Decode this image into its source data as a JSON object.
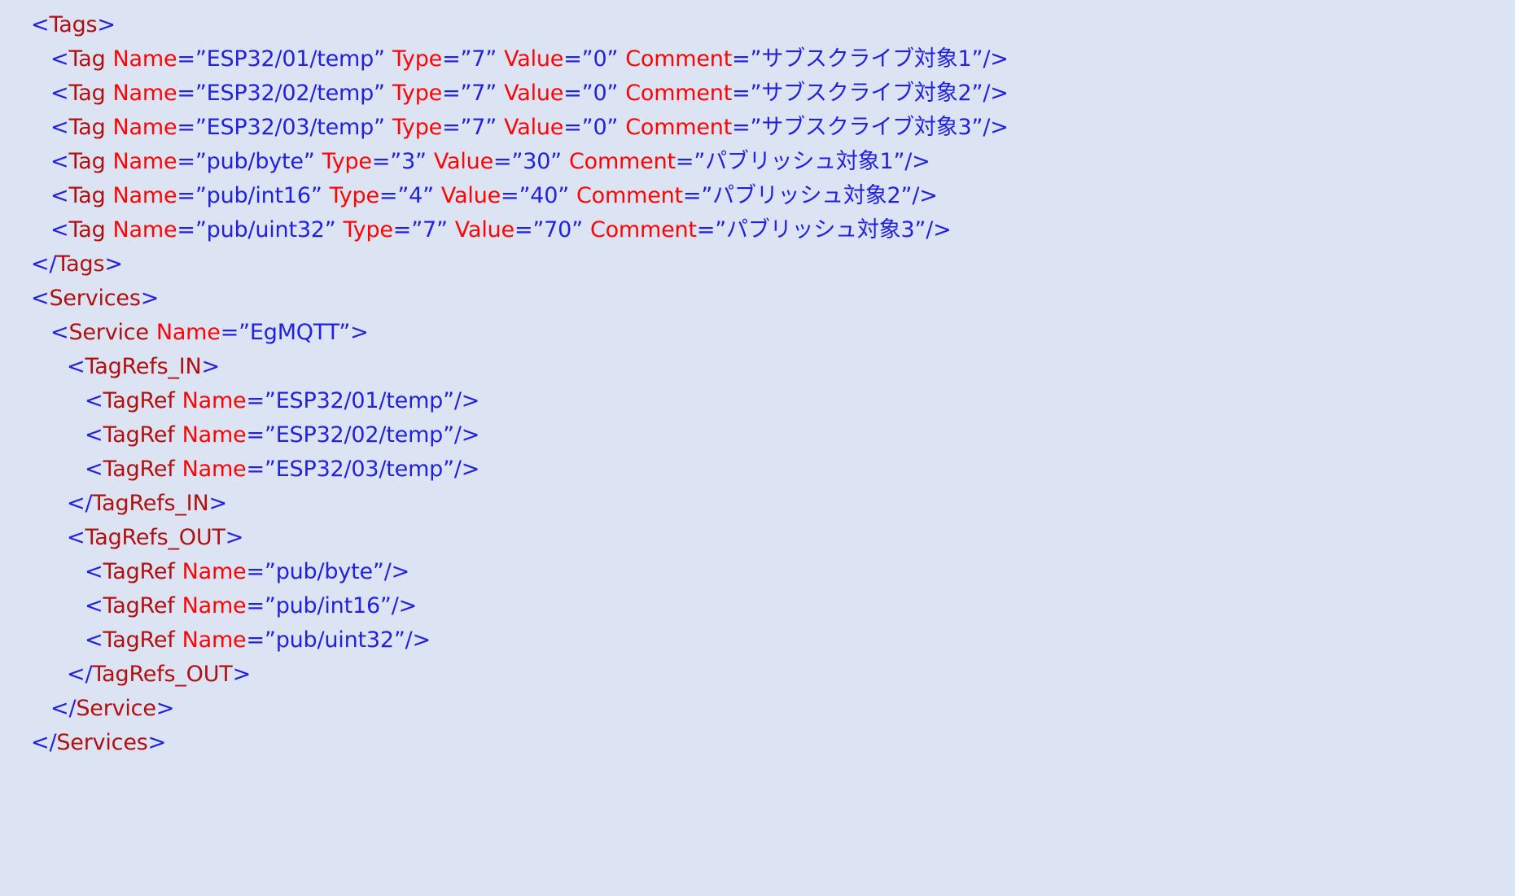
{
  "document": {
    "type": "xml-source-listing",
    "background_color": "#dce3f2",
    "colors": {
      "bracket": "#2222dd",
      "element_name": "#b01010",
      "attribute_name": "#fb0505",
      "attribute_value": "#2222dd"
    },
    "lines": [
      {
        "indent": 0,
        "text": "<Tags>"
      },
      {
        "indent": 1,
        "text": "<Tag Name=\"ESP32/01/temp\" Type=\"7\" Value=\"0\" Comment=\"サブスクライブ対象1\"/>"
      },
      {
        "indent": 1,
        "text": "<Tag Name=\"ESP32/02/temp\" Type=\"7\" Value=\"0\" Comment=\"サブスクライブ対象2\"/>"
      },
      {
        "indent": 1,
        "text": "<Tag Name=\"ESP32/03/temp\" Type=\"7\" Value=\"0\" Comment=\"サブスクライブ対象3\"/>"
      },
      {
        "indent": 1,
        "text": "<Tag Name=\"pub/byte\" Type=\"3\" Value=\"30\" Comment=\"パブリッシュ対象1\"/>"
      },
      {
        "indent": 1,
        "text": "<Tag Name=\"pub/int16\" Type=\"4\" Value=\"40\" Comment=\"パブリッシュ対象2\"/>"
      },
      {
        "indent": 1,
        "text": "<Tag Name=\"pub/uint32\" Type=\"7\" Value=\"70\" Comment=\"パブリッシュ対象3\"/>"
      },
      {
        "indent": 0,
        "text": "</Tags>"
      },
      {
        "indent": 0,
        "text": "<Services>"
      },
      {
        "indent": 1,
        "text": "<Service Name=\"EgMQTT\">"
      },
      {
        "indent": 2,
        "text": "<TagRefs_IN>"
      },
      {
        "indent": 3,
        "text": "<TagRef Name=\"ESP32/01/temp\"/>"
      },
      {
        "indent": 3,
        "text": "<TagRef Name=\"ESP32/02/temp\"/>"
      },
      {
        "indent": 3,
        "text": "<TagRef Name=\"ESP32/03/temp\"/>"
      },
      {
        "indent": 2,
        "text": "</TagRefs_IN>"
      },
      {
        "indent": 2,
        "text": "<TagRefs_OUT>"
      },
      {
        "indent": 3,
        "text": "<TagRef Name=\"pub/byte\"/>"
      },
      {
        "indent": 3,
        "text": "<TagRef Name=\"pub/int16\"/>"
      },
      {
        "indent": 3,
        "text": "<TagRef Name=\"pub/uint32\"/>"
      },
      {
        "indent": 2,
        "text": "</TagRefs_OUT>"
      },
      {
        "indent": 1,
        "text": "</Service>"
      },
      {
        "indent": 0,
        "text": "</Services>"
      }
    ],
    "tags": [
      {
        "element": "Tag",
        "name": "ESP32/01/temp",
        "type": "7",
        "value": "0",
        "comment": "サブスクライブ対象1"
      },
      {
        "element": "Tag",
        "name": "ESP32/02/temp",
        "type": "7",
        "value": "0",
        "comment": "サブスクライブ対象2"
      },
      {
        "element": "Tag",
        "name": "ESP32/03/temp",
        "type": "7",
        "value": "0",
        "comment": "サブスクライブ対象3"
      },
      {
        "element": "Tag",
        "name": "pub/byte",
        "type": "3",
        "value": "30",
        "comment": "パブリッシュ対象1"
      },
      {
        "element": "Tag",
        "name": "pub/int16",
        "type": "4",
        "value": "40",
        "comment": "パブリッシュ対象2"
      },
      {
        "element": "Tag",
        "name": "pub/uint32",
        "type": "7",
        "value": "70",
        "comment": "パブリッシュ対象3"
      }
    ],
    "services": [
      {
        "name": "EgMQTT",
        "tagrefs_in": [
          "ESP32/01/temp",
          "ESP32/02/temp",
          "ESP32/03/temp"
        ],
        "tagrefs_out": [
          "pub/byte",
          "pub/int16",
          "pub/uint32"
        ]
      }
    ],
    "labels": {
      "tags_open": "Tags",
      "tags_close": "Tags",
      "services_open": "Services",
      "service_open": "Service",
      "tagrefs_in": "TagRefs_IN",
      "tagrefs_out": "TagRefs_OUT",
      "tag": "Tag",
      "tagref": "TagRef",
      "attr_name": "Name",
      "attr_type": "Type",
      "attr_value": "Value",
      "attr_comment": "Comment"
    }
  }
}
